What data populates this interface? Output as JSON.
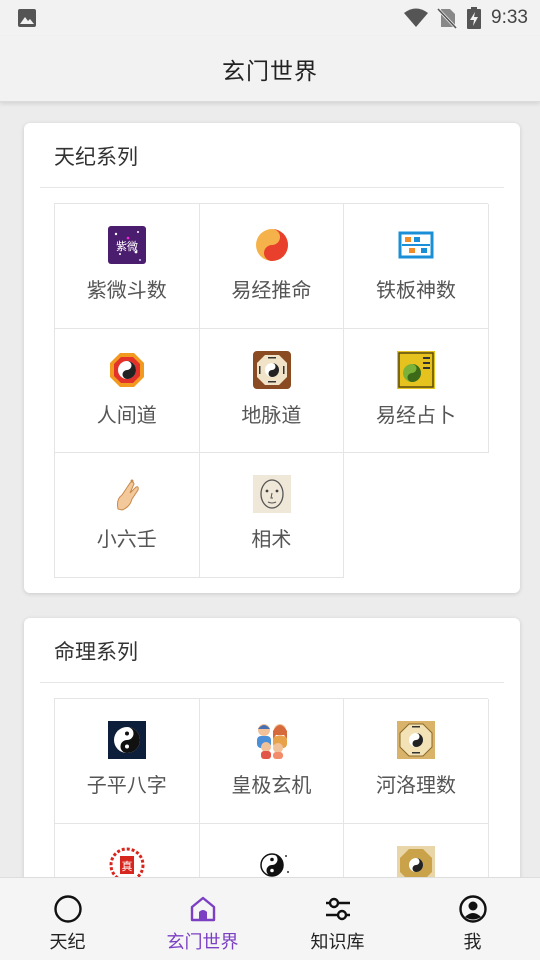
{
  "status_bar": {
    "time": "9:33",
    "icons": [
      "image-icon",
      "wifi-icon",
      "no-sim-icon",
      "battery-charging-icon"
    ]
  },
  "app_bar": {
    "title": "玄门世界"
  },
  "sections": [
    {
      "title": "天纪系列",
      "items": [
        {
          "label": "紫微斗数",
          "icon": "ziwei-icon"
        },
        {
          "label": "易经推命",
          "icon": "yijing-tuiming-icon"
        },
        {
          "label": "铁板神数",
          "icon": "abacus-icon"
        },
        {
          "label": "人间道",
          "icon": "bagua-icon"
        },
        {
          "label": "地脉道",
          "icon": "dimai-bagua-icon"
        },
        {
          "label": "易经占卜",
          "icon": "yijing-zhanbu-icon"
        },
        {
          "label": "小六壬",
          "icon": "hand-icon"
        },
        {
          "label": "相术",
          "icon": "face-icon"
        }
      ]
    },
    {
      "title": "命理系列",
      "items": [
        {
          "label": "子平八字",
          "icon": "taiji-icon"
        },
        {
          "label": "皇极玄机",
          "icon": "family-icon"
        },
        {
          "label": "河洛理数",
          "icon": "heluo-icon"
        },
        {
          "label": "",
          "icon": "red-seal-icon"
        },
        {
          "label": "",
          "icon": "yinyang-icon"
        },
        {
          "label": "",
          "icon": "bagua-gold-icon"
        }
      ]
    }
  ],
  "bottom_nav": {
    "active_index": 1,
    "items": [
      {
        "label": "天纪",
        "icon": "circle-icon"
      },
      {
        "label": "玄门世界",
        "icon": "home-icon"
      },
      {
        "label": "知识库",
        "icon": "sliders-icon"
      },
      {
        "label": "我",
        "icon": "profile-icon"
      }
    ]
  },
  "colors": {
    "accent": "#7b3fc4",
    "background": "#ececec",
    "card": "#ffffff",
    "bar": "#f2f2f2"
  }
}
